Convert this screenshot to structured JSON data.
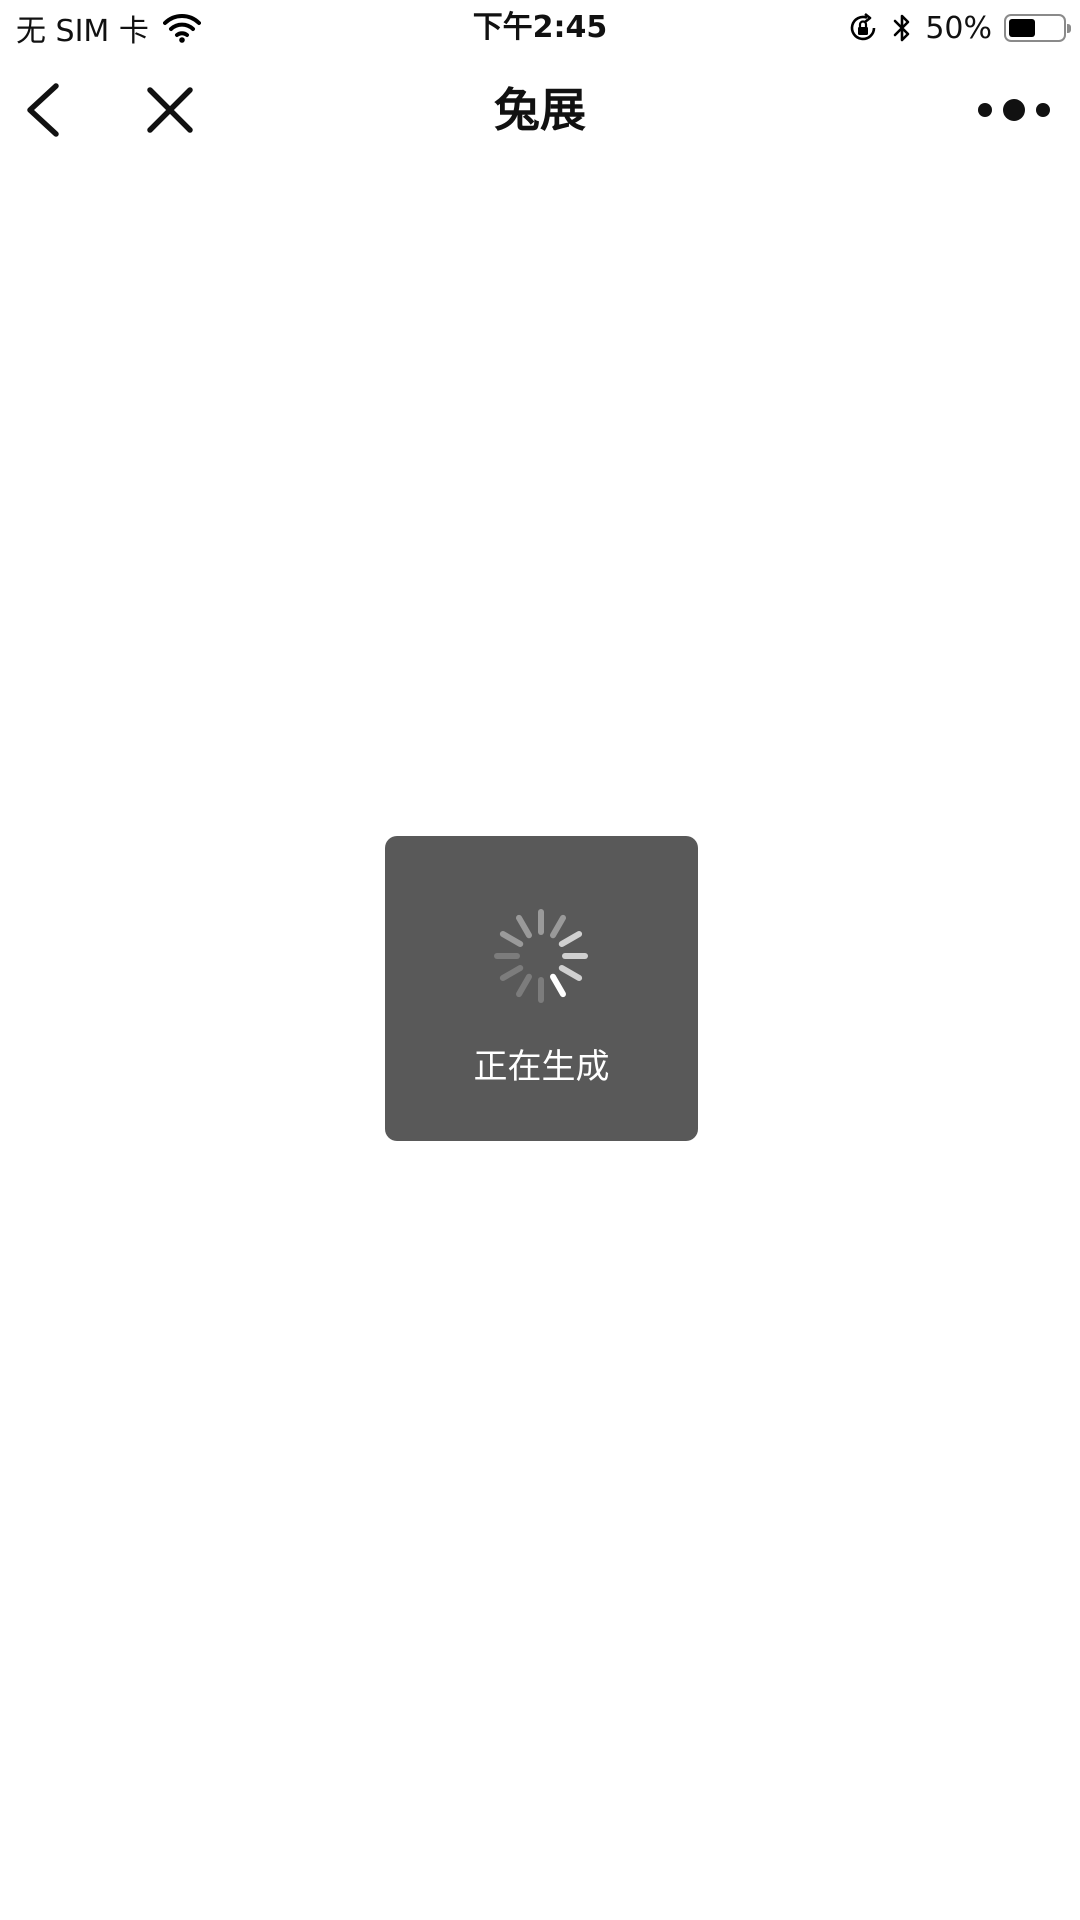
{
  "status_bar": {
    "carrier": "无 SIM 卡",
    "time": "下午2:45",
    "battery_text": "50%",
    "battery_level": 0.5,
    "icons": [
      "wifi-icon",
      "orientation-lock-icon",
      "bluetooth-icon",
      "battery-icon"
    ]
  },
  "nav": {
    "title": "兔展",
    "icons": [
      "back-chevron-icon",
      "close-icon",
      "more-dots-icon"
    ]
  },
  "toast": {
    "message": "正在生成",
    "icon": "spinner-icon",
    "background_color": "#595959"
  }
}
